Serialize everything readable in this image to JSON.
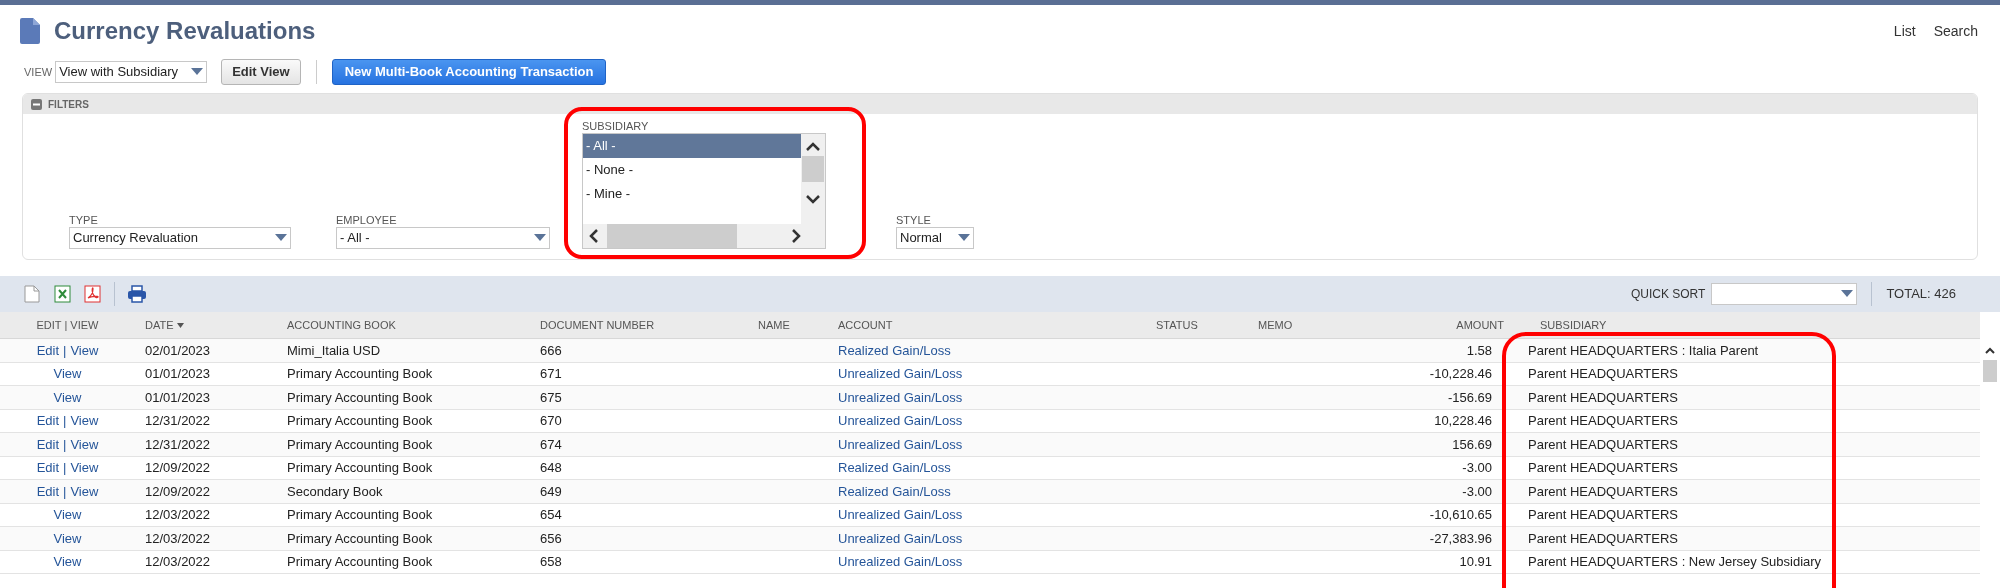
{
  "page": {
    "title": "Currency Revaluations",
    "nav_links": [
      "List",
      "Search"
    ]
  },
  "view_bar": {
    "label": "VIEW",
    "value": "View with Subsidiary",
    "edit_button": "Edit View",
    "primary_button": "New Multi-Book Accounting Transaction"
  },
  "filters": {
    "header": "FILTERS",
    "expanded": true,
    "fields": [
      {
        "kind": "select",
        "label": "TYPE",
        "value": "Currency Revaluation"
      },
      {
        "kind": "select",
        "label": "EMPLOYEE",
        "value": "- All -"
      },
      {
        "kind": "listbox",
        "label": "SUBSIDIARY",
        "annotated": true,
        "options": [
          {
            "label": "- All -",
            "selected": true
          },
          {
            "label": "- None -",
            "selected": false
          },
          {
            "label": "- Mine -",
            "selected": false
          }
        ]
      },
      {
        "kind": "select",
        "label": "STYLE",
        "value": "Normal"
      }
    ]
  },
  "toolbar": {
    "quick_sort_label": "QUICK SORT",
    "total": "TOTAL: 426"
  },
  "table": {
    "columns": [
      {
        "label": "EDIT | VIEW"
      },
      {
        "label": "DATE",
        "sorted": true
      },
      {
        "label": "ACCOUNTING BOOK"
      },
      {
        "label": "DOCUMENT NUMBER"
      },
      {
        "label": "NAME"
      },
      {
        "label": "ACCOUNT"
      },
      {
        "label": "STATUS"
      },
      {
        "label": "MEMO"
      },
      {
        "label": "AMOUNT"
      },
      {
        "label": "SUBSIDIARY",
        "annotated": true
      }
    ],
    "action_separator": "|",
    "rows": [
      {
        "actions": [
          "Edit",
          "View"
        ],
        "date": "02/01/2023",
        "book": "Mimi_Italia USD",
        "doc": "666",
        "account": "Realized Gain/Loss",
        "amount": "1.58",
        "subsidiary": "Parent HEADQUARTERS : Italia Parent"
      },
      {
        "actions": [
          "View"
        ],
        "date": "01/01/2023",
        "book": "Primary Accounting Book",
        "doc": "671",
        "account": "Unrealized Gain/Loss",
        "amount": "-10,228.46",
        "subsidiary": "Parent HEADQUARTERS"
      },
      {
        "actions": [
          "View"
        ],
        "date": "01/01/2023",
        "book": "Primary Accounting Book",
        "doc": "675",
        "account": "Unrealized Gain/Loss",
        "amount": "-156.69",
        "subsidiary": "Parent HEADQUARTERS"
      },
      {
        "actions": [
          "Edit",
          "View"
        ],
        "date": "12/31/2022",
        "book": "Primary Accounting Book",
        "doc": "670",
        "account": "Unrealized Gain/Loss",
        "amount": "10,228.46",
        "subsidiary": "Parent HEADQUARTERS"
      },
      {
        "actions": [
          "Edit",
          "View"
        ],
        "date": "12/31/2022",
        "book": "Primary Accounting Book",
        "doc": "674",
        "account": "Unrealized Gain/Loss",
        "amount": "156.69",
        "subsidiary": "Parent HEADQUARTERS"
      },
      {
        "actions": [
          "Edit",
          "View"
        ],
        "date": "12/09/2022",
        "book": "Primary Accounting Book",
        "doc": "648",
        "account": "Realized Gain/Loss",
        "amount": "-3.00",
        "subsidiary": "Parent HEADQUARTERS"
      },
      {
        "actions": [
          "Edit",
          "View"
        ],
        "date": "12/09/2022",
        "book": "Secondary Book",
        "doc": "649",
        "account": "Realized Gain/Loss",
        "amount": "-3.00",
        "subsidiary": "Parent HEADQUARTERS"
      },
      {
        "actions": [
          "View"
        ],
        "date": "12/03/2022",
        "book": "Primary Accounting Book",
        "doc": "654",
        "account": "Unrealized Gain/Loss",
        "amount": "-10,610.65",
        "subsidiary": "Parent HEADQUARTERS"
      },
      {
        "actions": [
          "View"
        ],
        "date": "12/03/2022",
        "book": "Primary Accounting Book",
        "doc": "656",
        "account": "Unrealized Gain/Loss",
        "amount": "-27,383.96",
        "subsidiary": "Parent HEADQUARTERS"
      },
      {
        "actions": [
          "View"
        ],
        "date": "12/03/2022",
        "book": "Primary Accounting Book",
        "doc": "658",
        "account": "Unrealized Gain/Loss",
        "amount": "10.91",
        "subsidiary": "Parent HEADQUARTERS : New Jersey Subsidiary"
      }
    ]
  }
}
